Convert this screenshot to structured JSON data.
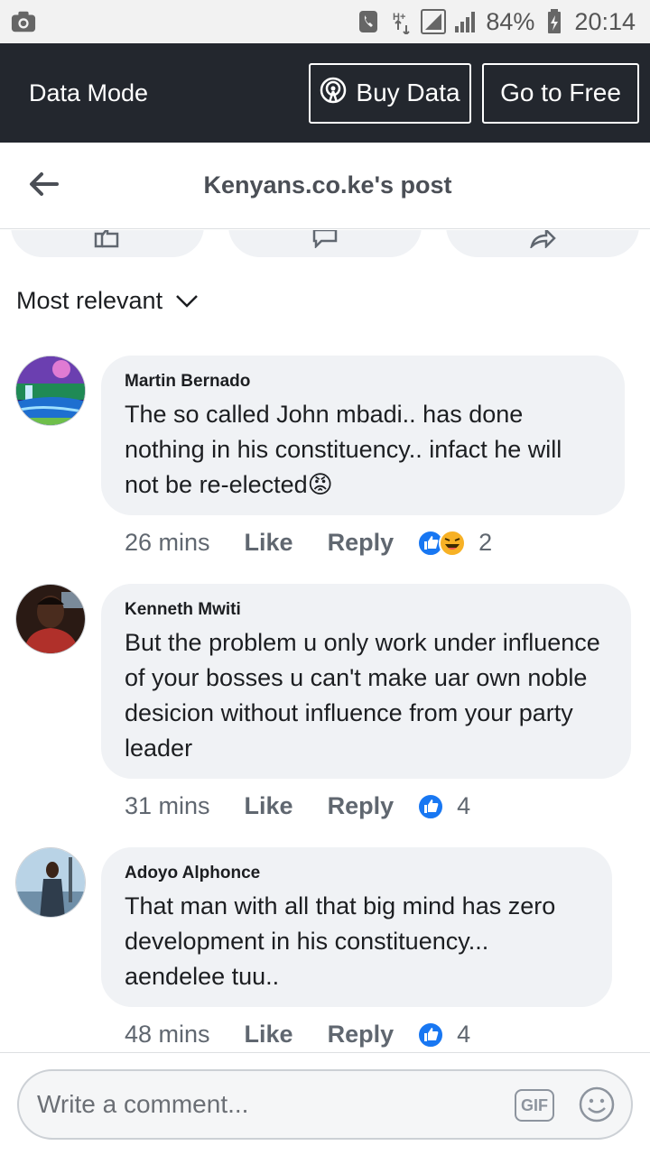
{
  "status_bar": {
    "battery": "84%",
    "time": "20:14",
    "network": "H+"
  },
  "data_mode": {
    "title": "Data Mode",
    "buy_label": "Buy Data",
    "free_label": "Go to Free"
  },
  "header": {
    "title": "Kenyans.co.ke's post"
  },
  "filter": {
    "label": "Most relevant"
  },
  "comments": [
    {
      "author": "Martin Bernado",
      "text": "The so called John mbadi.. has done nothing in his constituency.. infact he will not be re-elected😡",
      "time": "26 mins",
      "like": "Like",
      "reply": "Reply",
      "reactions": [
        "like",
        "haha"
      ],
      "reaction_count": "2"
    },
    {
      "author": "Kenneth Mwiti",
      "text": "But the problem u only work under influence of your bosses u can't make uar own noble desicion without influence from your party leader",
      "time": "31 mins",
      "like": "Like",
      "reply": "Reply",
      "reactions": [
        "like"
      ],
      "reaction_count": "4"
    },
    {
      "author": "Adoyo Alphonce",
      "text": "That man with all that big mind has zero development in his constituency... aendelee tuu..",
      "time": "48 mins",
      "like": "Like",
      "reply": "Reply",
      "reactions": [
        "like"
      ],
      "reaction_count": "4"
    }
  ],
  "composer": {
    "placeholder": "Write a comment...",
    "gif_label": "GIF"
  },
  "colors": {
    "like_blue": "#1877f2",
    "haha_yellow": "#f7b125",
    "dark_bar": "#23272e",
    "bubble_bg": "#f0f2f5"
  }
}
